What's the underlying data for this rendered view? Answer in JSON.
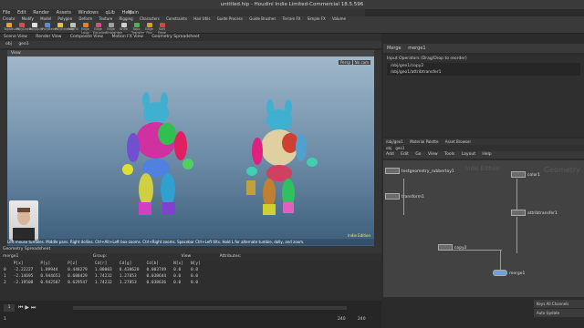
{
  "window": {
    "title": "untitled.hip - Houdini Indie Limited-Commercial 18.5.596"
  },
  "menu": [
    "File",
    "Edit",
    "Render",
    "Assets",
    "Windows",
    "qLib",
    "Help"
  ],
  "desktop": "Main",
  "shelf_tabs": [
    "Create",
    "Modify",
    "Model",
    "Polygon",
    "Deform",
    "Texture",
    "Rigging",
    "Characters",
    "Constraints",
    "Hair Utils",
    "Guide Process",
    "Guide Brushes",
    "Terrain FX",
    "Simple FX",
    "Volume"
  ],
  "shelf_tools": [
    "TopoBuild",
    "PolyDraw",
    "PolySplit",
    "PolyBevel",
    "PolyExtrude",
    "PolyFill",
    "Edge Loop",
    "Edge Equalize",
    "Edge Straighten",
    "Knife",
    "Topo Transfer",
    "Edge Flip",
    "Soft Edge"
  ],
  "viewport": {
    "tabs": [
      "Scene View",
      "Render View",
      "Composite View",
      "Motion FX View",
      "Geometry Spreadsheet"
    ],
    "path": "obj",
    "node": "geo1",
    "label": "View",
    "persp": "Persp",
    "camera": "No cam",
    "status": "Left mouse tumbles. Middle pans. Right dollies. Ctrl+Alt+Left box-zooms. Ctrl+Right zooms. Spacebar Ctrl+Left tilts. Hold L for alternate tumble, dolly, and zoom.",
    "indie": "Indie Edition"
  },
  "spreadsheet": {
    "tab": "Geometry Spreadsheet",
    "node": "merge1",
    "group": "Group:",
    "view": "View",
    "attributes": "Attributes:",
    "columns": [
      "",
      "P[x]",
      "P[y]",
      "P[z]",
      "Cd[r]",
      "Cd[g]",
      "Cd[b]",
      "N[x]",
      "N[y]"
    ],
    "rows": [
      [
        "0",
        "-2.22227",
        "1.89944",
        "0.448279",
        "1.00003",
        "0.438620",
        "0.003749",
        "0.0",
        "0.0"
      ],
      [
        "1",
        "-2.14695",
        "0.944653",
        "0.688429",
        "1.74232",
        "1.27853",
        "0.038644",
        "0.0",
        "0.0"
      ],
      [
        "2",
        "-2.19508",
        "0.942507",
        "0.629547",
        "1.74232",
        "1.27853",
        "0.038636",
        "0.0",
        "0.0"
      ]
    ]
  },
  "timeline": {
    "frame": "1",
    "start": "1",
    "end": "240",
    "end2": "240"
  },
  "params": {
    "header": "Merge",
    "node": "merge1",
    "label": "Input Operators (Drag/Drop to reorder)",
    "inputs": [
      "/obj/geo1/copy2",
      "/obj/geo1/attribtransfer1"
    ]
  },
  "network": {
    "tabs": [
      "/obj/geo1",
      "Material Palette",
      "Asset Browser"
    ],
    "menu": [
      "Add",
      "Edit",
      "Go",
      "View",
      "Tools",
      "Layout",
      "Help"
    ],
    "path": "obj",
    "node": "geo1",
    "watermark1": "Indie Edition",
    "watermark2": "Geometry",
    "nodes": [
      "testgeometry_rubbertoy1",
      "transform1",
      "color1",
      "color1",
      "attribtransfer1",
      "copy2",
      "merge1"
    ]
  },
  "bottom": {
    "btn1": "Keys All Channels",
    "btn2": "Auto Update"
  }
}
